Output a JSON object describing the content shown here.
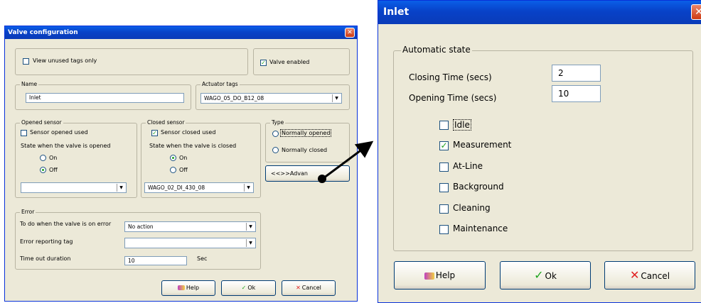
{
  "valve_config": {
    "title": "Valve configuration",
    "close_glyph": "✕",
    "view_unused_label": "View unused tags only",
    "view_unused_checked": false,
    "valve_enabled_label": "Valve enabled",
    "valve_enabled_checked": true,
    "name_group": "Name",
    "name_value": "Inlet",
    "actuator_group": "Actuator tags",
    "actuator_value": "WAGO_05_DO_B12_08",
    "opened_group": "Opened sensor",
    "opened_sensor_used_label": "Sensor opened used",
    "opened_state_label": "State when the valve is opened",
    "on_label": "On",
    "off_label": "Off",
    "opened_tag_value": "",
    "closed_group": "Closed sensor",
    "closed_sensor_used_label": "Sensor closed used",
    "closed_state_label": "State when the valve is closed",
    "closed_tag_value": "WAGO_02_DI_430_08",
    "type_group": "Type",
    "normally_opened_label": "Normally opened",
    "normally_closed_label": "Normally closed",
    "advanced_label": "Advan",
    "advanced_icon": "<<>>",
    "error_group": "Error",
    "error_action_label": "To do when the valve is on error",
    "error_action_value": "No action",
    "error_tag_label": "Error reporting tag",
    "error_tag_value": "",
    "timeout_label": "Time out duration",
    "timeout_value": "10",
    "timeout_unit": "Sec",
    "help_label": "Help",
    "ok_label": "Ok",
    "cancel_label": "Cancel"
  },
  "inlet": {
    "title": "Inlet",
    "close_glyph": "✕",
    "auto_group": "Automatic state",
    "closing_label": "Closing Time (secs)",
    "closing_value": "2",
    "opening_label": "Opening Time (secs)",
    "opening_value": "10",
    "states": [
      {
        "label": "Idle",
        "checked": false
      },
      {
        "label": "Measurement",
        "checked": true
      },
      {
        "label": "At-Line",
        "checked": false
      },
      {
        "label": "Background",
        "checked": false
      },
      {
        "label": "Cleaning",
        "checked": false
      },
      {
        "label": "Maintenance",
        "checked": false
      }
    ],
    "help_label": "Help",
    "ok_label": "Ok",
    "cancel_label": "Cancel"
  },
  "check_glyph": "✓",
  "dropdown_arrow": "▼",
  "colors": {
    "title_blue": "#0a5fe8",
    "check_green": "#21a121",
    "close_red": "#cf3a13"
  }
}
